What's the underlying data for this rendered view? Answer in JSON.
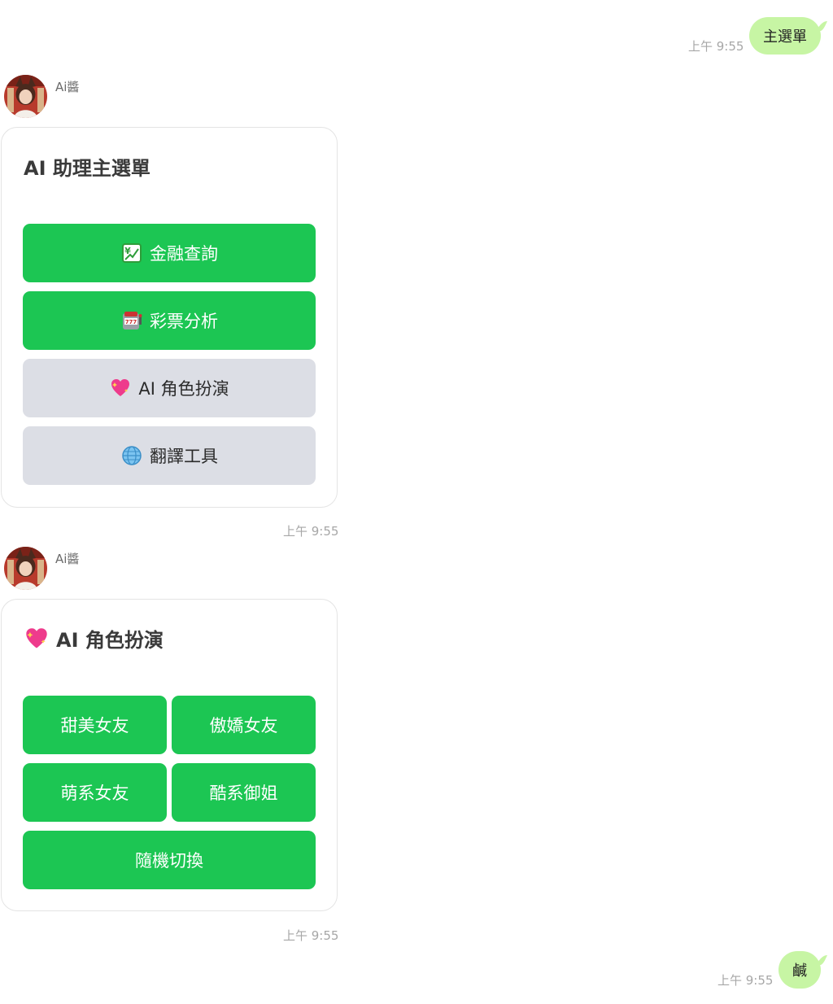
{
  "chat": {
    "messages": [
      {
        "type": "outgoing",
        "text": "主選單",
        "time": "上午 9:55"
      },
      {
        "type": "incoming-card",
        "sender": "Ai醬",
        "time": "上午 9:55",
        "card": {
          "title": "AI 助理主選單",
          "buttons": [
            {
              "icon": "chart-yen-icon",
              "label": "金融查詢",
              "style": "primary"
            },
            {
              "icon": "slot-machine-icon",
              "label": "彩票分析",
              "style": "primary"
            },
            {
              "icon": "sparkling-heart-icon",
              "label": "AI 角色扮演",
              "style": "secondary"
            },
            {
              "icon": "globe-icon",
              "label": "翻譯工具",
              "style": "secondary"
            }
          ]
        }
      },
      {
        "type": "incoming-card",
        "sender": "Ai醬",
        "time": "上午 9:55",
        "card": {
          "title_icon": "sparkling-heart-icon",
          "title": "AI 角色扮演",
          "buttons": [
            {
              "label": "甜美女友",
              "style": "primary"
            },
            {
              "label": "傲嬌女友",
              "style": "primary"
            },
            {
              "label": "萌系女友",
              "style": "primary"
            },
            {
              "label": "酷系御姐",
              "style": "primary"
            },
            {
              "label": "隨機切換",
              "style": "primary"
            }
          ]
        }
      },
      {
        "type": "outgoing",
        "text": "鹹",
        "time": "上午 9:55"
      }
    ]
  },
  "colors": {
    "outgoing_bubble": "#c7f5a4",
    "primary_button": "#1cc653",
    "secondary_button": "#dcdee5",
    "timestamp": "#a7a7a7"
  }
}
